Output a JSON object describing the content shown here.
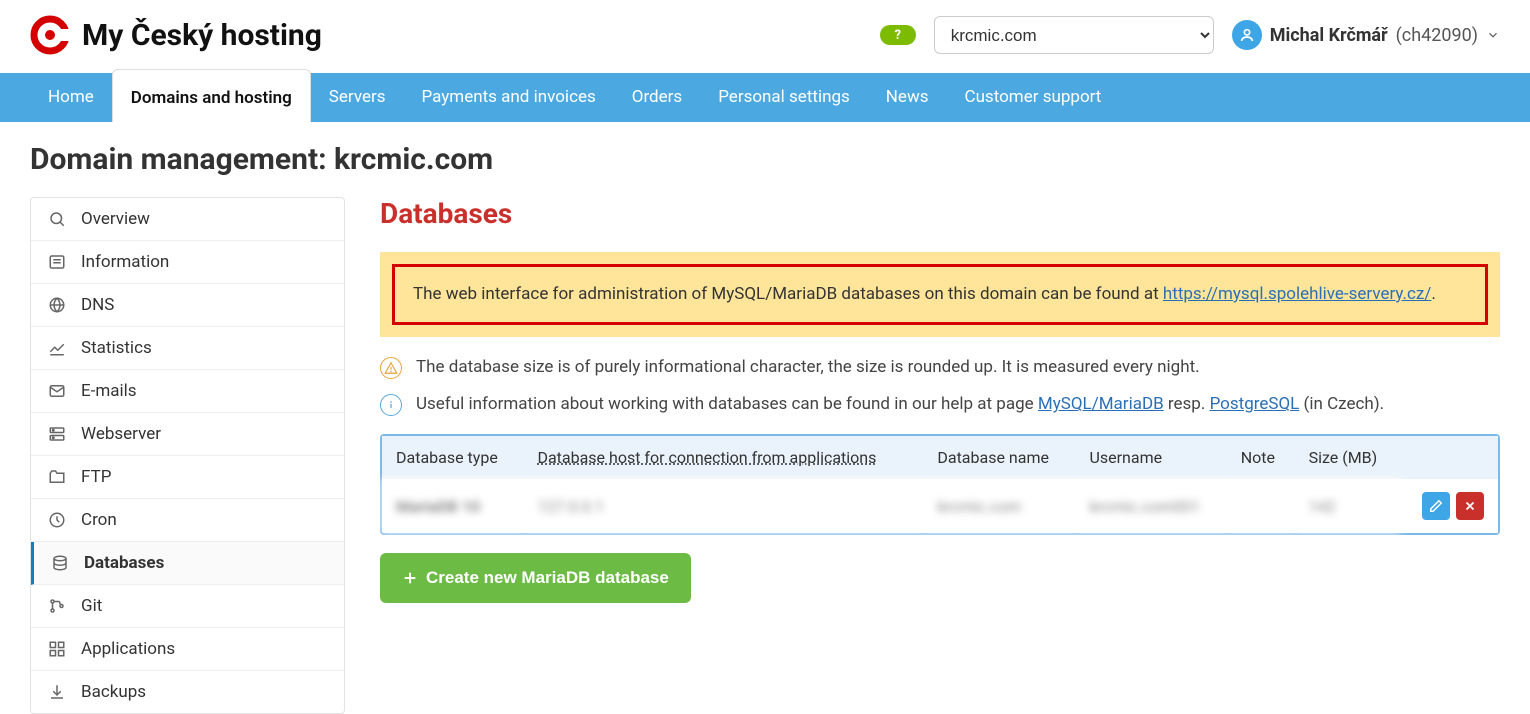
{
  "brand": {
    "title": "My Český hosting"
  },
  "header": {
    "domain_selected": "krcmic.com",
    "user_name": "Michal Krčmář",
    "user_code": "(ch42090)"
  },
  "nav": {
    "items": [
      {
        "label": "Home"
      },
      {
        "label": "Domains and hosting"
      },
      {
        "label": "Servers"
      },
      {
        "label": "Payments and invoices"
      },
      {
        "label": "Orders"
      },
      {
        "label": "Personal settings"
      },
      {
        "label": "News"
      },
      {
        "label": "Customer support"
      }
    ]
  },
  "page_title": "Domain management: krcmic.com",
  "sidebar": {
    "items": [
      {
        "label": "Overview",
        "icon": "search"
      },
      {
        "label": "Information",
        "icon": "info"
      },
      {
        "label": "DNS",
        "icon": "globe"
      },
      {
        "label": "Statistics",
        "icon": "stats"
      },
      {
        "label": "E-mails",
        "icon": "mail"
      },
      {
        "label": "Webserver",
        "icon": "server"
      },
      {
        "label": "FTP",
        "icon": "folder"
      },
      {
        "label": "Cron",
        "icon": "clock"
      },
      {
        "label": "Databases",
        "icon": "db"
      },
      {
        "label": "Git",
        "icon": "git"
      },
      {
        "label": "Applications",
        "icon": "apps"
      },
      {
        "label": "Backups",
        "icon": "download"
      }
    ]
  },
  "content": {
    "section_title": "Databases",
    "alert_prefix": "The web interface for administration of MySQL/MariaDB databases on this domain can be found at ",
    "alert_link": "https://mysql.spolehlive-servery.cz/",
    "alert_suffix": ".",
    "info1": "The database size is of purely informational character, the size is rounded up. It is measured every night.",
    "info2_prefix": "Useful information about working with databases can be found in our help at page ",
    "info2_link1": "MySQL/MariaDB",
    "info2_mid": " resp. ",
    "info2_link2": "PostgreSQL",
    "info2_suffix": " (in Czech).",
    "table": {
      "columns": [
        "Database type",
        "Database host for connection from applications",
        "Database name",
        "Username",
        "Note",
        "Size (MB)"
      ],
      "row": {
        "type": "MariaDB 10",
        "host": "127.0.0.1",
        "name": "krcmic.com",
        "user": "krcmic.com001",
        "note": "",
        "size": "142"
      }
    },
    "create_button": "Create new MariaDB database"
  }
}
